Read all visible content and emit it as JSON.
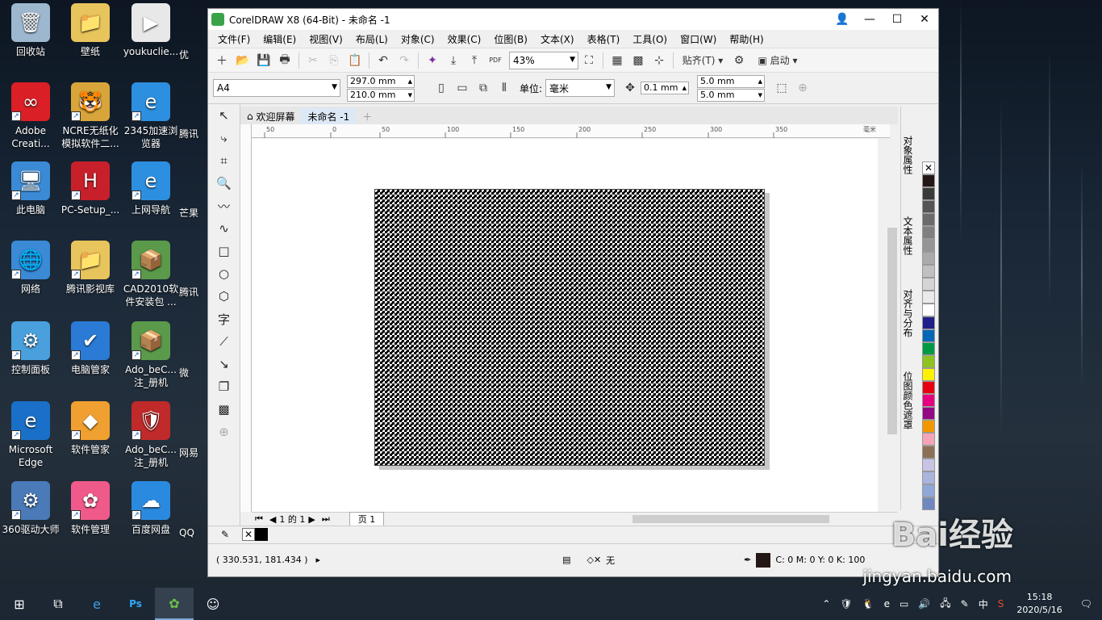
{
  "desktop": {
    "icons": [
      {
        "label": "回收站",
        "color": "#9db7cf",
        "glyph": "🗑"
      },
      {
        "label": "壁纸",
        "color": "#e8c45c",
        "glyph": "📁"
      },
      {
        "label": "youkuclie...",
        "color": "#e8e8e8",
        "glyph": "▶"
      },
      {
        "label": "Adobe Creati...",
        "color": "#da1f26",
        "glyph": "∞"
      },
      {
        "label": "NCRE无纸化模拟软件二...",
        "color": "#d8a53a",
        "glyph": "🐯"
      },
      {
        "label": "2345加速浏览器",
        "color": "#2c8fe0",
        "glyph": "e"
      },
      {
        "label": "此电脑",
        "color": "#3a8ad6",
        "glyph": "🖥"
      },
      {
        "label": "PC-Setup_...",
        "color": "#c8202a",
        "glyph": "H"
      },
      {
        "label": "上网导航",
        "color": "#2c8fe0",
        "glyph": "e"
      },
      {
        "label": "网络",
        "color": "#3a8ad6",
        "glyph": "🌐"
      },
      {
        "label": "腾讯影视库",
        "color": "#e8c45c",
        "glyph": "📁"
      },
      {
        "label": "CAD2010软件安装包 ...",
        "color": "#5a9a4a",
        "glyph": "📦"
      },
      {
        "label": "控制面板",
        "color": "#4aa0dc",
        "glyph": "⚙"
      },
      {
        "label": "电脑管家",
        "color": "#2a7ad6",
        "glyph": "✔"
      },
      {
        "label": "Ado_beC... 注_册机",
        "color": "#5a9a4a",
        "glyph": "📦"
      },
      {
        "label": "Microsoft Edge",
        "color": "#1a70c8",
        "glyph": "e"
      },
      {
        "label": "软件管家",
        "color": "#f0a030",
        "glyph": "◆"
      },
      {
        "label": "Ado_beC... 注_册机",
        "color": "#c02a2a",
        "glyph": "🛡"
      },
      {
        "label": "360驱动大师",
        "color": "#4a7ab8",
        "glyph": "⚙"
      },
      {
        "label": "软件管理",
        "color": "#f05a8a",
        "glyph": "✿"
      },
      {
        "label": "百度网盘",
        "color": "#2a8ae0",
        "glyph": "☁"
      }
    ],
    "partial_icons": [
      "优",
      "腾讯",
      "芒果",
      "腾讯",
      "微",
      "网易",
      "QQ"
    ]
  },
  "window": {
    "title": "CorelDRAW X8 (64-Bit) - 未命名 -1",
    "menu": [
      "文件(F)",
      "编辑(E)",
      "视图(V)",
      "布局(L)",
      "对象(C)",
      "效果(C)",
      "位图(B)",
      "文本(X)",
      "表格(T)",
      "工具(O)",
      "窗口(W)",
      "帮助(H)"
    ],
    "zoom": "43%",
    "snap_label": "贴齐(T)",
    "launch_label": "启动",
    "page_size": "A4",
    "width": "297.0 mm",
    "height": "210.0 mm",
    "units_label": "单位:",
    "units": "毫米",
    "nudge": "0.1 mm",
    "dup_x": "5.0 mm",
    "dup_y": "5.0 mm",
    "tabs": [
      "欢迎屏幕",
      "未命名 -1"
    ],
    "ruler_ticks": [
      "50",
      "0",
      "50",
      "100",
      "150",
      "200",
      "250",
      "300",
      "350"
    ],
    "ruler_unit": "毫米",
    "pager": {
      "current": "1",
      "of": "的",
      "total": "1",
      "page_tab": "页 1"
    },
    "dockers": [
      "对象属性",
      "文本属性",
      "对齐与分布",
      "位图颜色遮罩"
    ],
    "palette": [
      "#231815",
      "#3a3a3a",
      "#555555",
      "#6b6b6b",
      "#808080",
      "#959595",
      "#aaaaaa",
      "#c0c0c0",
      "#d5d5d5",
      "#eaeaea",
      "#ffffff",
      "#1d2088",
      "#0068b7",
      "#009944",
      "#8fc31f",
      "#fff100",
      "#e60012",
      "#e4007f",
      "#920783",
      "#f39800",
      "#f5a3b8",
      "#8c7055",
      "#c9c3e6",
      "#aab4dd",
      "#8fa8d8",
      "#7088c0"
    ],
    "status": {
      "coords": "( 330.531, 181.434 )",
      "fill_none": "无",
      "outline": "C: 0 M: 0 Y: 0 K: 100"
    }
  },
  "taskbar": {
    "time": "15:18",
    "date": "2020/5/16",
    "ime": "中"
  },
  "watermark": {
    "brand": "Bai经验",
    "url": "jingyan.baidu.com"
  }
}
